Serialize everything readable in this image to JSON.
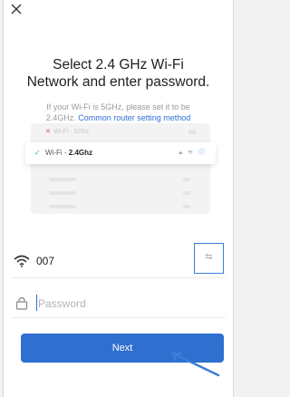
{
  "header": {
    "close_icon": "close-icon"
  },
  "title": {
    "line1": "Select 2.4 GHz Wi-Fi",
    "line2": "Network and enter password."
  },
  "subtitle": {
    "text_line1": "If your Wi-Fi is 5GHz, please set it to be",
    "text_line2_prefix": "2.4GHz.",
    "link": "Common router setting method"
  },
  "illustration": {
    "row1_label": "Wi-Fi - 5Ghz",
    "row2_prefix": "Wi-Fi - ",
    "row2_band": "2.4Ghz"
  },
  "network": {
    "ssid": "007",
    "wifi_icon": "wifi-icon",
    "switch_icon": "switch-network-icon"
  },
  "password": {
    "placeholder": "Password",
    "lock_icon": "lock-icon"
  },
  "actions": {
    "next_label": "Next"
  },
  "colors": {
    "accent": "#2e6fd0",
    "link": "#2f6fd6",
    "check": "#2ebd6f",
    "error": "#e05050"
  }
}
